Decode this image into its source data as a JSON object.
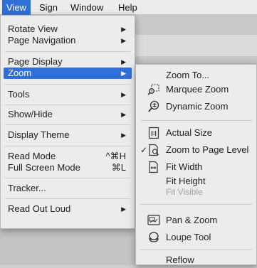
{
  "menubar": {
    "items": [
      {
        "label": "View",
        "active": true
      },
      {
        "label": "Sign"
      },
      {
        "label": "Window"
      },
      {
        "label": "Help"
      }
    ]
  },
  "view_menu": {
    "items": [
      {
        "label": "Rotate View",
        "arrow": "▶"
      },
      {
        "label": "Page Navigation",
        "arrow": "▶"
      },
      {
        "label": "Page Display",
        "arrow": "▶"
      },
      {
        "label": "Zoom",
        "arrow": "▶"
      },
      {
        "label": "Tools",
        "arrow": "▶"
      },
      {
        "label": "Show/Hide",
        "arrow": "▶"
      },
      {
        "label": "Display Theme",
        "arrow": "▶"
      },
      {
        "label": "Read Mode",
        "shortcut": "^⌘H"
      },
      {
        "label": "Full Screen Mode",
        "shortcut": "⌘L"
      },
      {
        "label": "Tracker..."
      },
      {
        "label": "Read Out Loud",
        "arrow": "▶"
      }
    ]
  },
  "zoom_submenu": {
    "items": [
      {
        "label": "Zoom To..."
      },
      {
        "label": "Marquee Zoom",
        "icon": "marquee-zoom-icon"
      },
      {
        "label": "Dynamic Zoom",
        "icon": "dynamic-zoom-icon"
      },
      {
        "label": "Actual Size",
        "icon": "actual-size-icon"
      },
      {
        "label": "Zoom to Page Level",
        "icon": "zoom-page-level-icon",
        "checked": "✓"
      },
      {
        "label": "Fit Width",
        "icon": "fit-width-icon"
      },
      {
        "label": "Fit Height"
      },
      {
        "label": "Fit Visible",
        "disabled": true
      },
      {
        "label": "Pan & Zoom",
        "icon": "pan-zoom-icon"
      },
      {
        "label": "Loupe Tool",
        "icon": "loupe-tool-icon"
      },
      {
        "label": "Reflow"
      }
    ]
  },
  "colors": {
    "highlight": "#2f6fd8",
    "menu_bg": "#ececec"
  }
}
